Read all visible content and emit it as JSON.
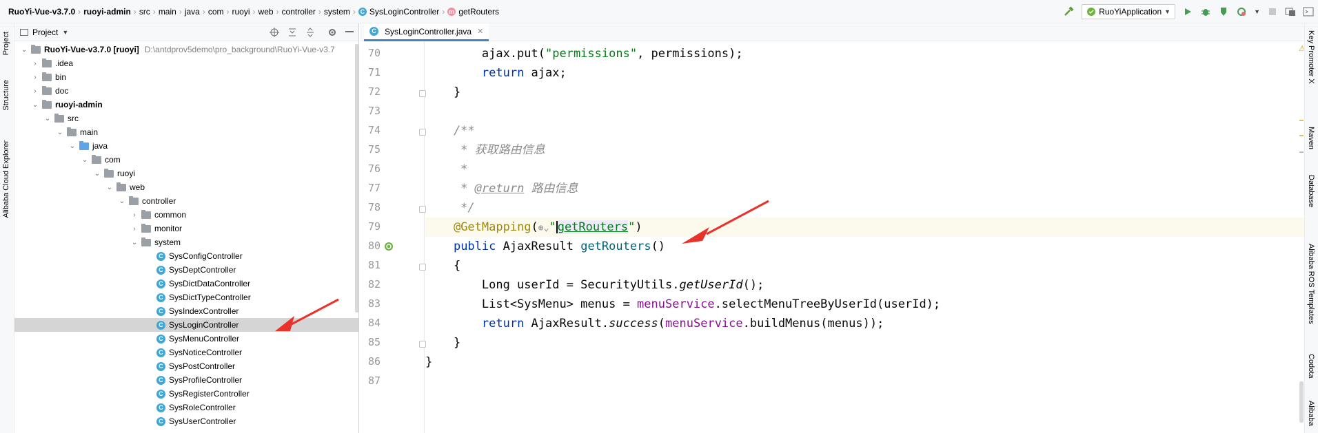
{
  "breadcrumb": [
    {
      "label": "RuoYi-Vue-v3.7.0",
      "bold": true
    },
    {
      "label": "ruoyi-admin",
      "bold": true
    },
    {
      "label": "src"
    },
    {
      "label": "main"
    },
    {
      "label": "java"
    },
    {
      "label": "com"
    },
    {
      "label": "ruoyi"
    },
    {
      "label": "web"
    },
    {
      "label": "controller"
    },
    {
      "label": "system"
    },
    {
      "label": "SysLoginController",
      "icon": "C"
    },
    {
      "label": "getRouters",
      "icon": "m"
    }
  ],
  "toolbar": {
    "run_config": "RuoYiApplication"
  },
  "left_strip": {
    "tabs": [
      "Project",
      "Structure",
      "Alibaba Cloud Explorer"
    ]
  },
  "project_panel": {
    "title": "Project",
    "root": {
      "label": "RuoYi-Vue-v3.7.0 [ruoyi]",
      "path": "D:\\antdprov5demo\\pro_background\\RuoYi-Vue-v3.7"
    },
    "items": [
      {
        "label": ".idea"
      },
      {
        "label": "bin"
      },
      {
        "label": "doc"
      },
      {
        "label": "ruoyi-admin"
      },
      {
        "label": "src"
      },
      {
        "label": "main"
      },
      {
        "label": "java"
      },
      {
        "label": "com"
      },
      {
        "label": "ruoyi"
      },
      {
        "label": "web"
      },
      {
        "label": "controller"
      },
      {
        "label": "common"
      },
      {
        "label": "monitor"
      },
      {
        "label": "system"
      },
      {
        "label": "SysConfigController"
      },
      {
        "label": "SysDeptController"
      },
      {
        "label": "SysDictDataController"
      },
      {
        "label": "SysDictTypeController"
      },
      {
        "label": "SysIndexController"
      },
      {
        "label": "SysLoginController"
      },
      {
        "label": "SysMenuController"
      },
      {
        "label": "SysNoticeController"
      },
      {
        "label": "SysPostController"
      },
      {
        "label": "SysProfileController"
      },
      {
        "label": "SysRegisterController"
      },
      {
        "label": "SysRoleController"
      },
      {
        "label": "SysUserController"
      }
    ]
  },
  "editor": {
    "tab_label": "SysLoginController.java",
    "line_numbers": [
      "70",
      "71",
      "72",
      "73",
      "74",
      "75",
      "76",
      "77",
      "78",
      "79",
      "80",
      "81",
      "82",
      "83",
      "84",
      "85",
      "86",
      "87"
    ]
  },
  "right_strip": {
    "tabs": [
      "Key Promoter X",
      "Maven",
      "Database",
      "Alibaba ROS Templates",
      "Codota",
      "Alibaba"
    ]
  },
  "colors": {
    "accent": "#4083c9",
    "arrow": "#e8322b",
    "selection": "#d5d5d5",
    "current_line": "#fcfaed"
  }
}
